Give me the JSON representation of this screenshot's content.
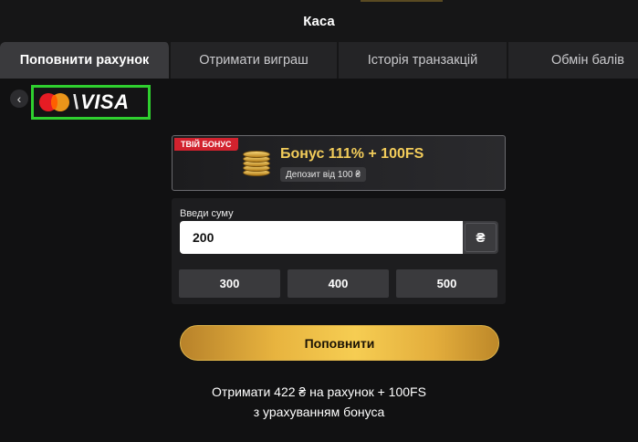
{
  "header": {
    "title": "Каса"
  },
  "tabs": [
    {
      "label": "Поповнити рахунок",
      "active": true
    },
    {
      "label": "Отримати виграш",
      "active": false
    },
    {
      "label": "Історія транзакцій",
      "active": false
    },
    {
      "label": "Обмін балів",
      "active": false
    }
  ],
  "payment_method": {
    "back_icon": "chevron-left-icon",
    "logos": [
      "mastercard-logo",
      "visa-logo"
    ],
    "visa_text": "VISA",
    "selected_border_color": "#2fd02f"
  },
  "bonus": {
    "tag": "ТВІЙ БОНУС",
    "title": "Бонус 111% + 100FS",
    "subtitle": "Депозит від 100 ₴",
    "icon": "coins-icon",
    "tag_color": "#d2222e",
    "title_color": "#f2cc5a"
  },
  "amount": {
    "label": "Введи суму",
    "value": "200",
    "currency": "₴",
    "presets": [
      "300",
      "400",
      "500"
    ]
  },
  "submit": {
    "label": "Поповнити"
  },
  "summary": {
    "line1": "Отримати 422 ₴ на рахунок + 100FS",
    "line2": "з урахуванням бонуса"
  }
}
